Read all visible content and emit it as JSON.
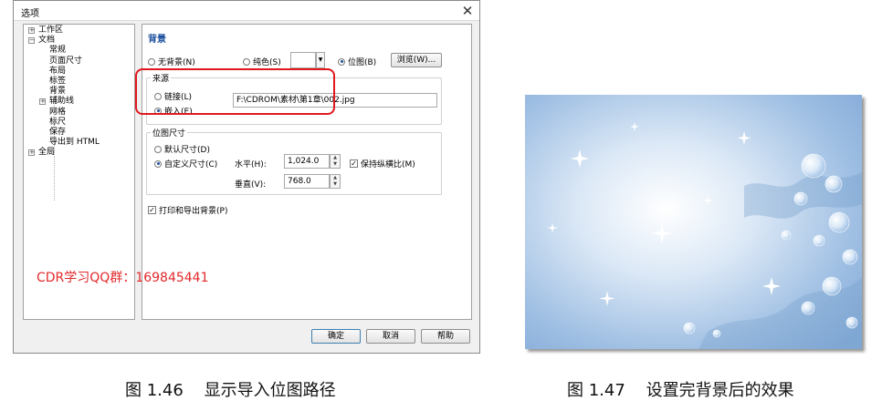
{
  "dialog": {
    "title": "选项",
    "close_glyph": "✕",
    "tree": [
      {
        "label": "工作区",
        "level": 0,
        "expander": "+"
      },
      {
        "label": "文档",
        "level": 0,
        "expander": "−"
      },
      {
        "label": "常规",
        "level": 1
      },
      {
        "label": "页面尺寸",
        "level": 1
      },
      {
        "label": "布局",
        "level": 1
      },
      {
        "label": "标签",
        "level": 1
      },
      {
        "label": "背景",
        "level": 1
      },
      {
        "label": "辅助线",
        "level": 1,
        "expander": "+"
      },
      {
        "label": "网格",
        "level": 1
      },
      {
        "label": "标尺",
        "level": 1
      },
      {
        "label": "保存",
        "level": 1
      },
      {
        "label": "导出到 HTML",
        "level": 1
      },
      {
        "label": "全局",
        "level": 0,
        "expander": "+"
      }
    ],
    "panel": {
      "section_title": "背景",
      "no_background": "无背景(N)",
      "solid_color": "纯色(S)",
      "bitmap": "位图(B)",
      "browse_button": "浏览(W)...",
      "source_group": "来源",
      "link": "链接(L)",
      "embed": "嵌入(E)",
      "path_value": "F:\\CDROM\\素材\\第1章\\002.jpg",
      "bitmap_size_group": "位图尺寸",
      "default_size": "默认尺寸(D)",
      "custom_size": "自定义尺寸(C)",
      "horizontal_label": "水平(H):",
      "horizontal_value": "1,024.0",
      "vertical_label": "垂直(V):",
      "vertical_value": "768.0",
      "keep_aspect": "保持纵横比(M)",
      "print_export": "打印和导出背景(P)"
    },
    "buttons": {
      "ok": "确定",
      "cancel": "取消",
      "help": "帮助"
    },
    "selected": {
      "background_mode": "bitmap",
      "source": "embed",
      "size": "custom",
      "keep_aspect": true,
      "print_export": true
    }
  },
  "watermark": "CDR学习QQ群：169845441",
  "captions": {
    "left": "图 1.46    显示导入位图路径",
    "right": "图 1.47    设置完背景后的效果"
  },
  "colors": {
    "highlight": "#e0181e",
    "section_title": "#1a4e9c",
    "watermark": "#e3282c"
  }
}
